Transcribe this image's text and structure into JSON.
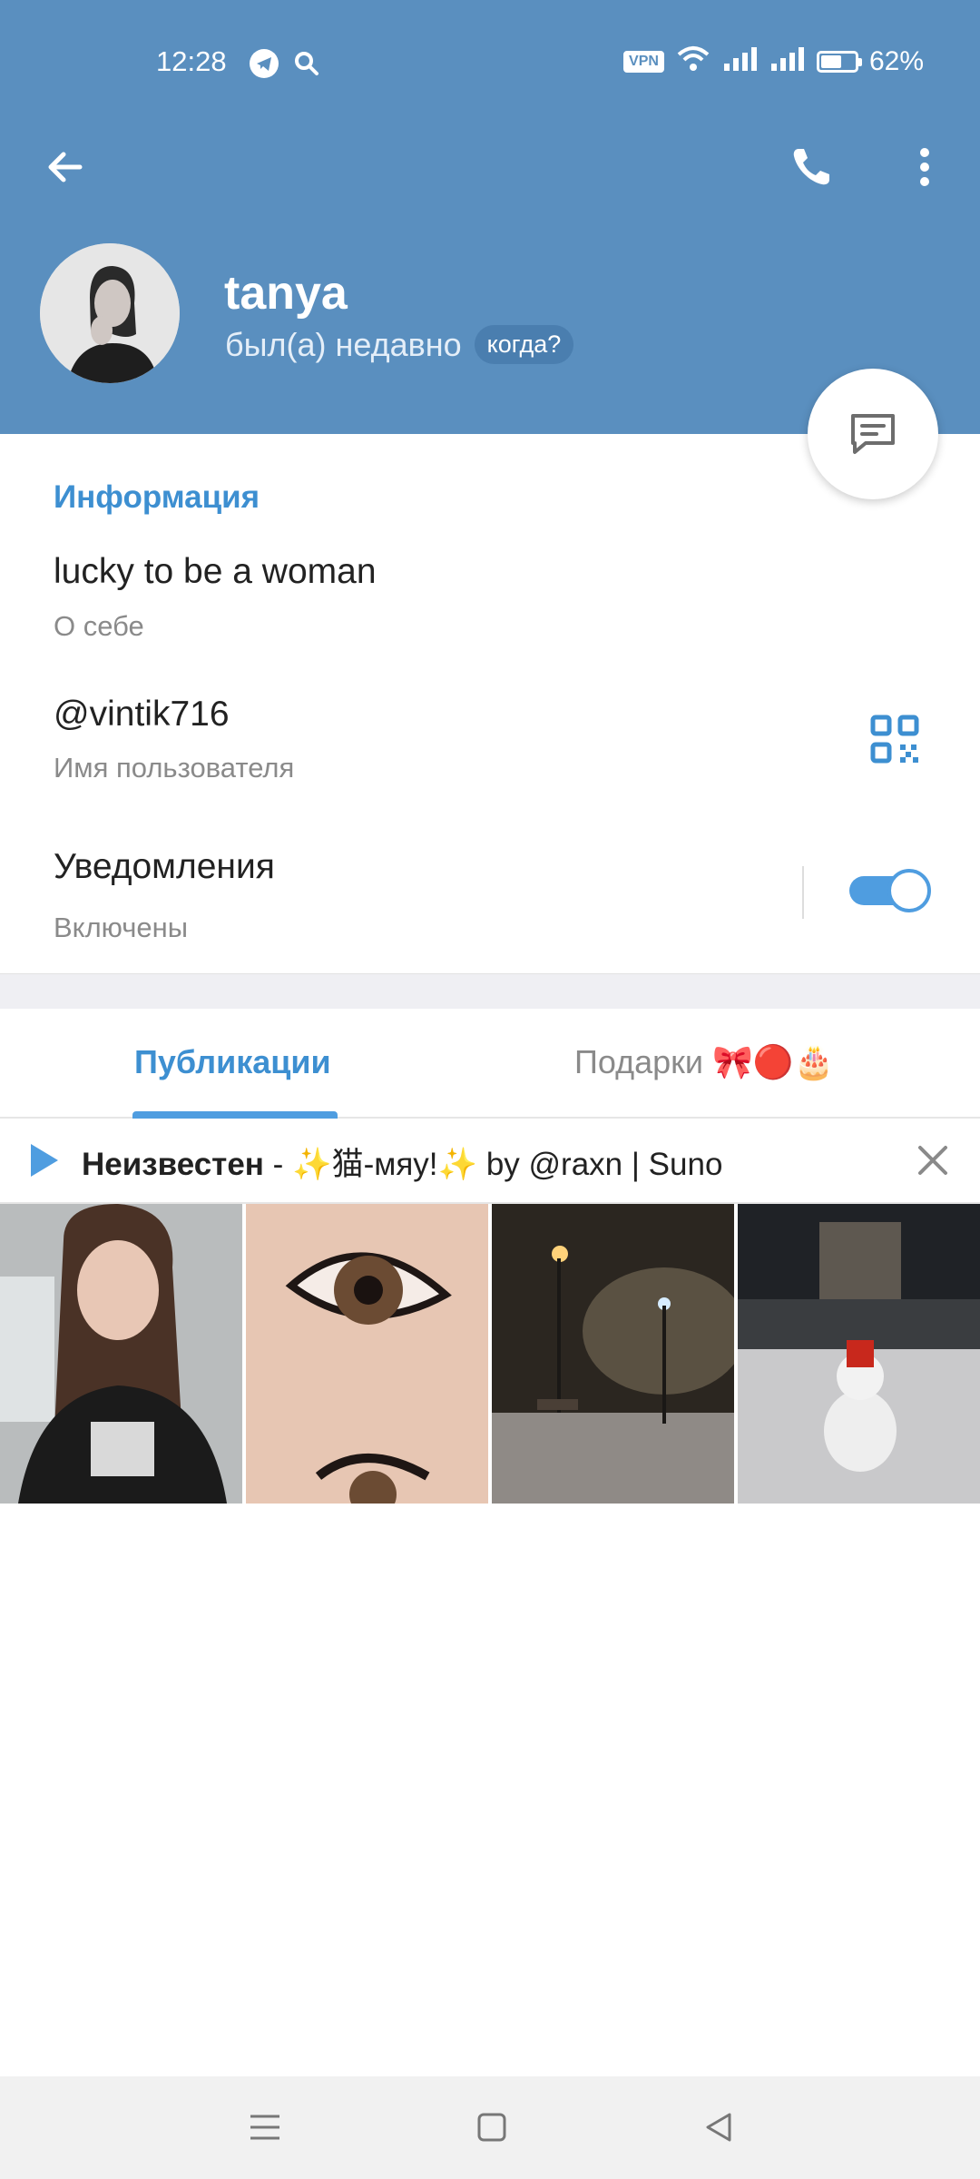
{
  "status_bar": {
    "time": "12:28",
    "vpn": "VPN",
    "battery": "62%",
    "battery_level": 0.62
  },
  "header": {
    "name": "tanya",
    "last_seen": "был(а) недавно",
    "when_label": "когда?"
  },
  "info": {
    "section_title": "Информация",
    "bio": "lucky to be a woman",
    "bio_label": "О себе",
    "username": "@vintik716",
    "username_label": "Имя пользователя",
    "notifications": "Уведомления",
    "notifications_state": "Включены",
    "notifications_on": true
  },
  "tabs": {
    "posts": "Публикации",
    "gifts": "Подарки 🎀🔴🎂",
    "active": "posts"
  },
  "music": {
    "artist": "Неизвестен",
    "title": " - ✨猫-мяу!✨ by @raxn | Suno"
  },
  "colors": {
    "header_bg": "#5a8fbf",
    "accent": "#3d8fd1",
    "toggle_on": "#4f9de0"
  },
  "icons": {
    "back": "arrow-left-icon",
    "call": "phone-icon",
    "more": "dots-vertical-icon",
    "message": "chat-bubble-icon",
    "qr": "qr-code-icon",
    "play": "play-icon",
    "close": "close-icon"
  }
}
